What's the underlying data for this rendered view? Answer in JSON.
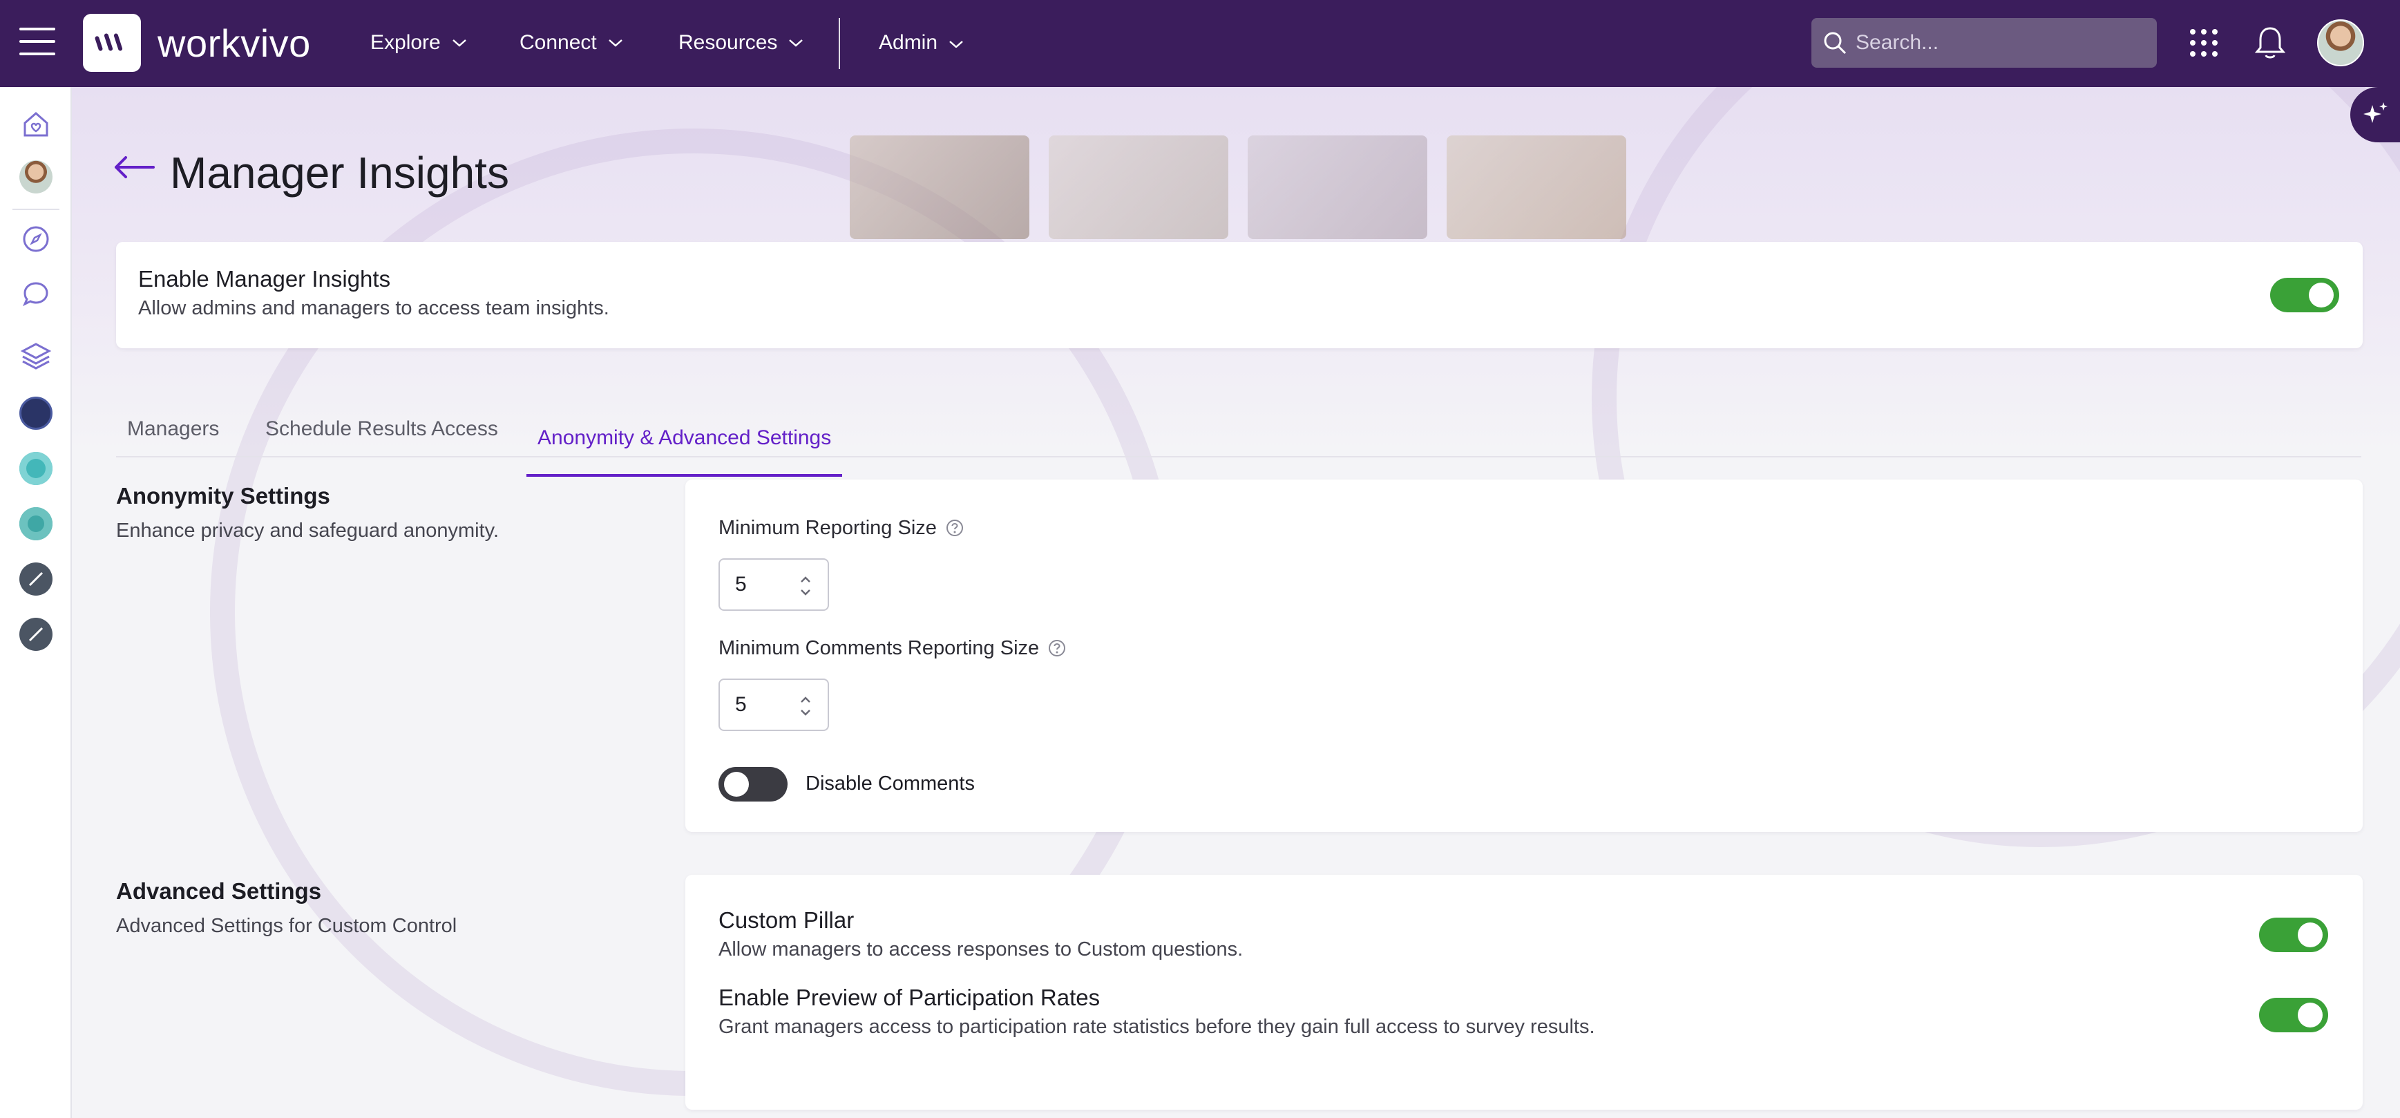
{
  "brand": {
    "name": "workvivo"
  },
  "nav": {
    "items": [
      {
        "label": "Explore"
      },
      {
        "label": "Connect"
      },
      {
        "label": "Resources"
      },
      {
        "label": "Admin"
      }
    ],
    "search_placeholder": "Search..."
  },
  "page": {
    "title": "Manager Insights"
  },
  "enable_card": {
    "title": "Enable Manager Insights",
    "subtitle": "Allow admins and managers to access team insights.",
    "enabled": true
  },
  "tabs": [
    {
      "label": "Managers",
      "active": false
    },
    {
      "label": "Schedule Results Access",
      "active": false
    },
    {
      "label": "Anonymity & Advanced Settings",
      "active": true
    }
  ],
  "anonymity": {
    "title": "Anonymity Settings",
    "subtitle": "Enhance privacy and safeguard anonymity.",
    "min_reporting_label": "Minimum Reporting Size",
    "min_reporting_value": "5",
    "min_comments_label": "Minimum Comments Reporting Size",
    "min_comments_value": "5",
    "disable_comments_label": "Disable Comments",
    "disable_comments_enabled": false
  },
  "advanced": {
    "title": "Advanced Settings",
    "subtitle": "Advanced Settings for Custom Control",
    "custom_pillar_title": "Custom Pillar",
    "custom_pillar_sub": "Allow managers to access responses to Custom questions.",
    "custom_pillar_enabled": true,
    "participation_title": "Enable Preview of Participation Rates",
    "participation_sub": "Grant managers access to participation rate statistics before they gain full access to survey results.",
    "participation_enabled": true
  },
  "colors": {
    "topbar": "#3b1d5c",
    "accent": "#6320c8",
    "toggle_on": "#3aa137",
    "toggle_off": "#3b3b42"
  }
}
